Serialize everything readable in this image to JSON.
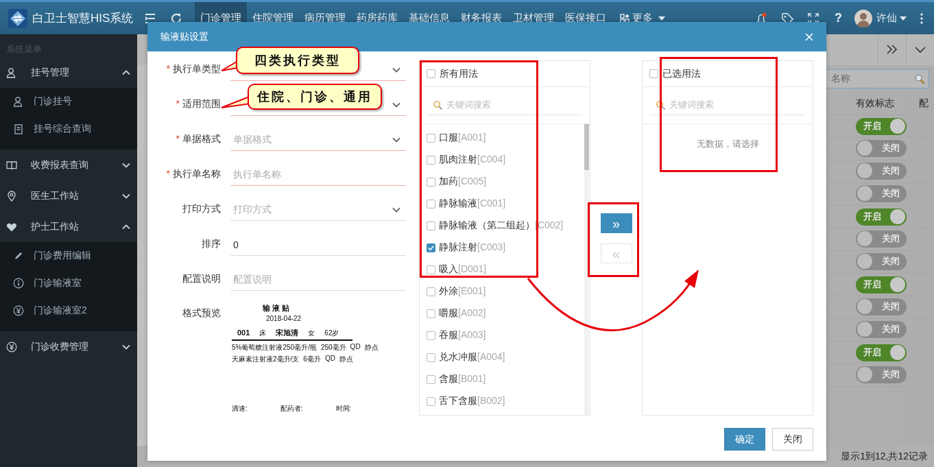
{
  "app": {
    "title": "白卫士智慧HIS系统"
  },
  "top_nav": [
    {
      "label": "门诊管理",
      "selected": true
    },
    {
      "label": "住院管理",
      "selected": false
    },
    {
      "label": "病历管理",
      "selected": false
    },
    {
      "label": "药房药库",
      "selected": false
    },
    {
      "label": "基础信息",
      "selected": false
    },
    {
      "label": "财务报表",
      "selected": false
    },
    {
      "label": "卫材管理",
      "selected": false
    },
    {
      "label": "医保接口",
      "selected": false
    }
  ],
  "more_menu": {
    "label": "更多"
  },
  "help": {
    "label": "?"
  },
  "user": {
    "name": "许仙",
    "notification": true
  },
  "sidebar": {
    "title": "系统菜单",
    "items": [
      {
        "label": "挂号管理",
        "expanded": true,
        "children": [
          {
            "label": "门诊挂号"
          },
          {
            "label": "挂号综合查询"
          }
        ]
      },
      {
        "label": "收费报表查询",
        "expanded": false
      },
      {
        "label": "医生工作站",
        "expanded": false
      },
      {
        "label": "护士工作站",
        "expanded": true,
        "children": [
          {
            "label": "门诊费用编辑"
          },
          {
            "label": "门诊输液室"
          },
          {
            "label": "门诊输液室2"
          }
        ]
      },
      {
        "label": "门诊收费管理",
        "expanded": false
      }
    ]
  },
  "background_table": {
    "search": {
      "placeholder": "名称"
    },
    "columns": [
      "有效标志",
      "配"
    ],
    "rows": [
      {
        "on": true,
        "label": "开启"
      },
      {
        "on": false,
        "label": "关闭"
      },
      {
        "on": false,
        "label": "关闭"
      },
      {
        "on": false,
        "label": "关闭"
      },
      {
        "on": true,
        "label": "开启"
      },
      {
        "on": false,
        "label": "关闭"
      },
      {
        "on": false,
        "label": "关闭"
      },
      {
        "on": true,
        "label": "开启"
      },
      {
        "on": false,
        "label": "关闭"
      },
      {
        "on": false,
        "label": "关闭"
      },
      {
        "on": true,
        "label": "开启"
      },
      {
        "on": false,
        "label": "关闭"
      }
    ],
    "footer": "显示1到12,共12记录"
  },
  "dialog": {
    "title": "输液贴设置",
    "required_mark": "*",
    "fields": [
      {
        "label": "执行单类型",
        "required": true,
        "kind": "select"
      },
      {
        "label": "适用范围",
        "required": true,
        "kind": "select"
      },
      {
        "label": "单据格式",
        "required": true,
        "kind": "select",
        "placeholder": "单据格式"
      },
      {
        "label": "执行单名称",
        "required": true,
        "kind": "input",
        "placeholder": "执行单名称"
      },
      {
        "label": "打印方式",
        "required": false,
        "kind": "select",
        "placeholder": "打印方式"
      },
      {
        "label": "排序",
        "required": false,
        "kind": "input",
        "value": "0"
      },
      {
        "label": "配置说明",
        "required": false,
        "kind": "input",
        "placeholder": "配置说明"
      }
    ],
    "preview": {
      "label": "格式预览",
      "title": "输 液 贴",
      "date": "2018-04-22",
      "bed": "001",
      "bed_label": "床",
      "patient": "宋旭清",
      "sex": "女",
      "age": "62岁",
      "lines": [
        [
          "5%葡萄糖注射液250毫升/瓶",
          "250毫升",
          "QD",
          "静点"
        ],
        [
          "天麻素注射液2毫升/支",
          "6毫升",
          "QD",
          "静点"
        ]
      ],
      "signatures": [
        "滴速:",
        "配药者:",
        "时间:"
      ]
    },
    "source": {
      "title": "所有用法",
      "checked": false,
      "search_placeholder": "关键词搜索",
      "items": [
        {
          "name": "口服",
          "code": "[A001]",
          "checked": false
        },
        {
          "name": "肌肉注射",
          "code": "[C004]",
          "checked": false
        },
        {
          "name": "加药",
          "code": "[C005]",
          "checked": false
        },
        {
          "name": "静脉输液",
          "code": "[C001]",
          "checked": false
        },
        {
          "name": "静脉输液（第二组起）",
          "code": "[C002]",
          "checked": false
        },
        {
          "name": "静脉注射",
          "code": "[C003]",
          "checked": true
        },
        {
          "name": "吸入",
          "code": "[D001]",
          "checked": false
        },
        {
          "name": "外涂",
          "code": "[E001]",
          "checked": false
        },
        {
          "name": "嚼服",
          "code": "[A002]",
          "checked": false
        },
        {
          "name": "吞服",
          "code": "[A003]",
          "checked": false
        },
        {
          "name": "兑水冲服",
          "code": "[A004]",
          "checked": false
        },
        {
          "name": "含服",
          "code": "[B001]",
          "checked": false
        },
        {
          "name": "舌下含服",
          "code": "[B002]",
          "checked": false
        }
      ]
    },
    "transfer_buttons": [
      {
        "label": "»",
        "disabled": false
      },
      {
        "label": "«",
        "disabled": true
      }
    ],
    "target": {
      "title": "已选用法",
      "checked": false,
      "search_placeholder": "关键词搜索",
      "empty_text": "无数据，请选择"
    },
    "buttons": [
      {
        "label": "确定",
        "kind": "primary"
      },
      {
        "label": "关闭",
        "kind": "default"
      }
    ]
  },
  "annotations": {
    "callouts": [
      "四类执行类型",
      "住院、门诊、通用"
    ]
  }
}
